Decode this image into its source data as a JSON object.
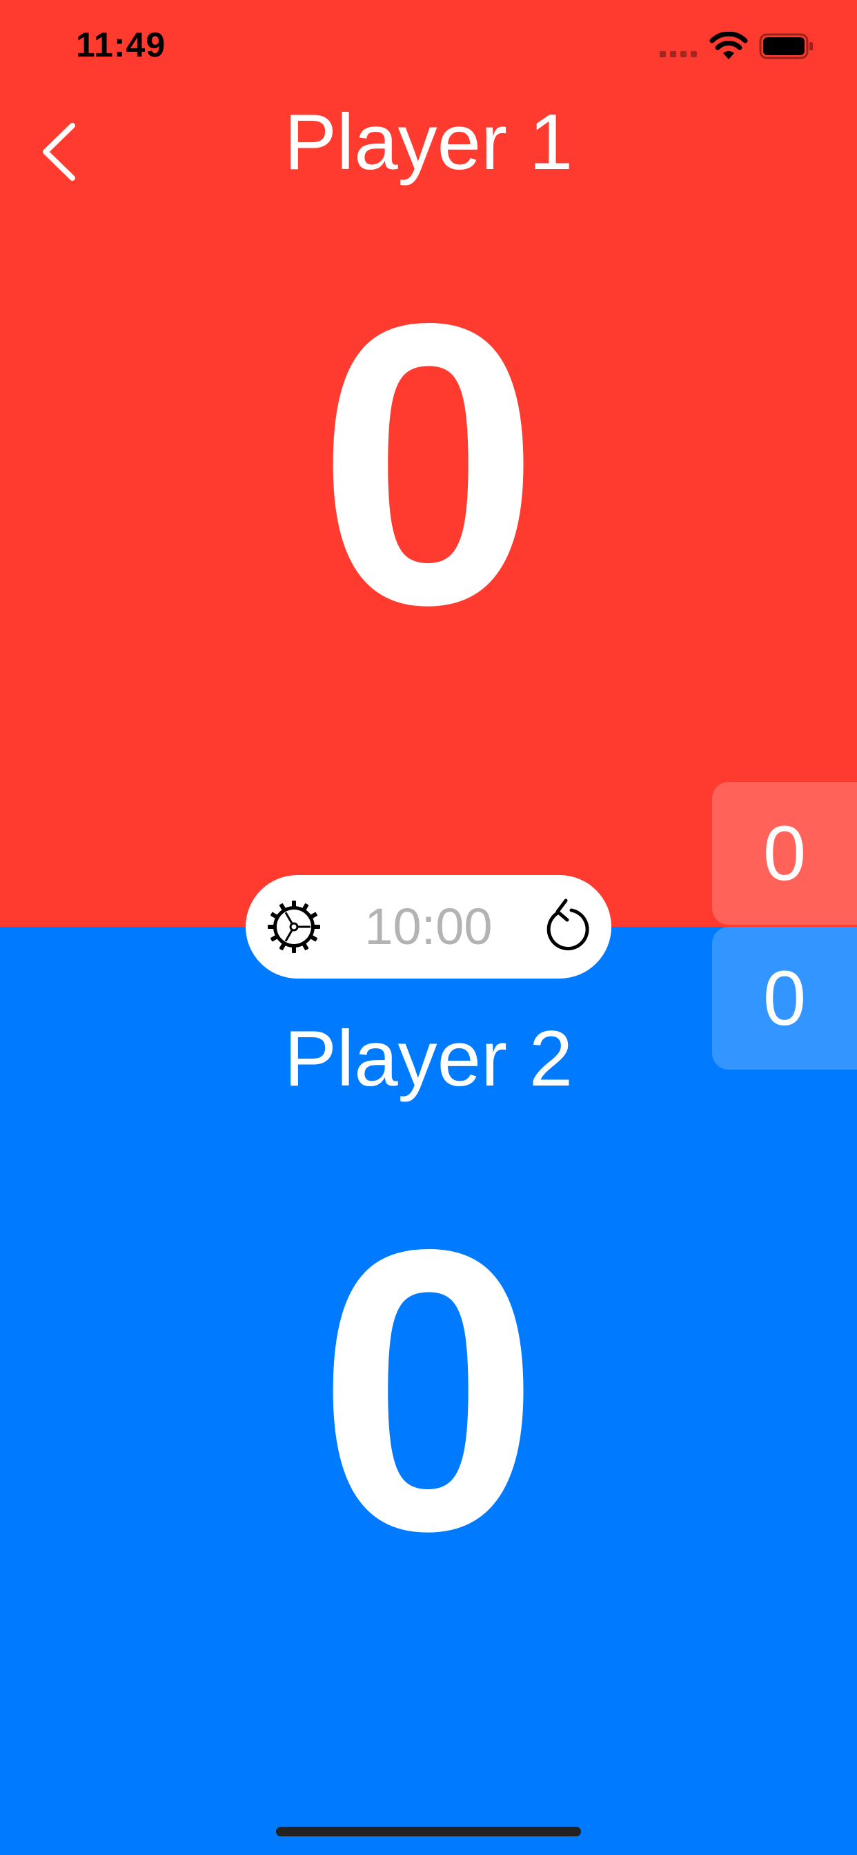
{
  "status_bar": {
    "time": "11:49",
    "signal_icon": "cellular-signal-icon",
    "wifi_icon": "wifi-icon",
    "battery_icon": "battery-icon"
  },
  "header": {
    "back_icon": "chevron-left-icon"
  },
  "player1": {
    "name": "Player 1",
    "score": "0",
    "sets": "0",
    "color": "#FF3B30",
    "sets_color": "#FF6259"
  },
  "player2": {
    "name": "Player 2",
    "score": "0",
    "sets": "0",
    "color": "#007AFF",
    "sets_color": "#3395FF"
  },
  "timer": {
    "value": "10:00",
    "settings_icon": "gear-icon",
    "reset_icon": "reset-icon"
  }
}
